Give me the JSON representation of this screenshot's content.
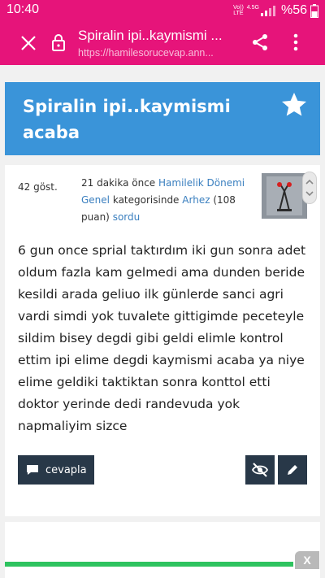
{
  "status_bar": {
    "time": "10:40",
    "network_top": "Vo))",
    "network_bottom": "LTE",
    "signal_label": "4.5G",
    "battery": "%56"
  },
  "browser": {
    "title": "Spiralin ipi..kaymismi ...",
    "url": "https://hamilesorucevap.ann..."
  },
  "question": {
    "title": "Spiralin ipi..kaymismi acaba",
    "views": "42 göst.",
    "meta": {
      "time_ago": "21 dakika önce",
      "category": "Hamilelik Dönemi Genel",
      "category_suffix": "kategorisinde",
      "user": "Arhez",
      "points": "(108 puan)",
      "action": "sordu"
    },
    "body": "6 gun once sprial taktırdım iki gun sonra adet oldum fazla kam gelmedi ama dunden beride kesildi arada geliuo ilk günlerde sanci agri vardi simdi yok tuvalete gittigimde peceteyle  sildim bisey degdi gibi geldi elimle kontrol ettim ipi elime degdi kaymismi acaba ya niye elime geldiki taktiktan sonra konttol etti doktor yerinde dedi randevuda yok napmaliyim sizce"
  },
  "actions": {
    "reply_label": "cevapla"
  },
  "footer": {
    "close_label": "X"
  },
  "colors": {
    "accent": "#e6147a",
    "header_blue": "#3a94d9",
    "button_dark": "#283848",
    "link": "#3a7fbf",
    "progress": "#2ec35f"
  }
}
